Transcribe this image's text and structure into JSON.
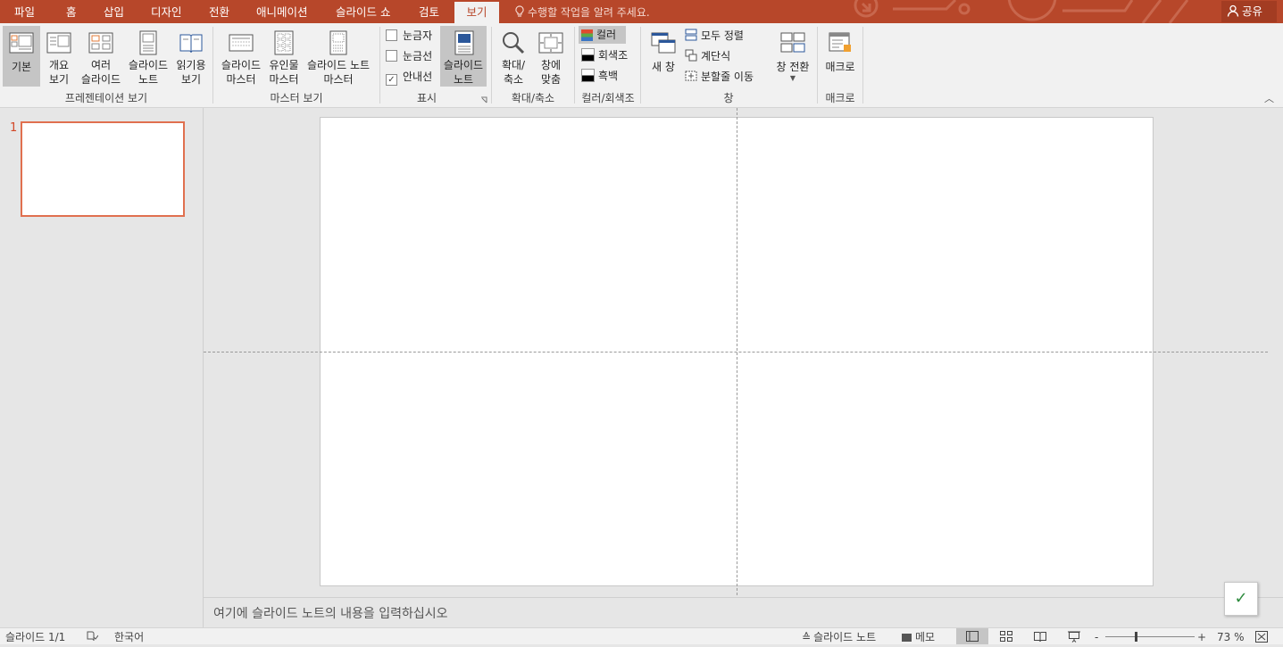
{
  "tabs": [
    {
      "label": "파일",
      "active": false
    },
    {
      "label": "홈",
      "active": false
    },
    {
      "label": "삽입",
      "active": false
    },
    {
      "label": "디자인",
      "active": false
    },
    {
      "label": "전환",
      "active": false
    },
    {
      "label": "애니메이션",
      "active": false
    },
    {
      "label": "슬라이드 쇼",
      "active": false
    },
    {
      "label": "검토",
      "active": false
    },
    {
      "label": "보기",
      "active": true
    }
  ],
  "tell_me": "수행할 작업을 알려 주세요.",
  "share_label": "공유",
  "ribbon": {
    "presentation_views": {
      "group_label": "프레젠테이션 보기",
      "normal": "기본",
      "outline": [
        "개요",
        "보기"
      ],
      "slide_sorter": [
        "여러",
        "슬라이드"
      ],
      "notes_page": [
        "슬라이드",
        "노트"
      ],
      "reading_view": [
        "읽기용",
        "보기"
      ]
    },
    "master_views": {
      "group_label": "마스터 보기",
      "slide_master": [
        "슬라이드",
        "마스터"
      ],
      "handout_master": [
        "유인물",
        "마스터"
      ],
      "notes_master": [
        "슬라이드 노트",
        "마스터"
      ]
    },
    "show": {
      "group_label": "표시",
      "ruler": {
        "label": "눈금자",
        "checked": false
      },
      "gridlines": {
        "label": "눈금선",
        "checked": false
      },
      "guides": {
        "label": "안내선",
        "checked": true
      },
      "notes": [
        "슬라이드",
        "노트"
      ]
    },
    "zoom": {
      "group_label": "확대/축소",
      "zoom": [
        "확대/",
        "축소"
      ],
      "fit_window": [
        "창에",
        "맞춤"
      ]
    },
    "color": {
      "group_label": "컬러/회색조",
      "color": "컬러",
      "grayscale": "회색조",
      "bw": "흑백"
    },
    "window": {
      "group_label": "창",
      "new_window": "새 창",
      "arrange_all": "모두 정렬",
      "cascade": "계단식",
      "move_split": "분할줄 이동",
      "switch_windows": "창 전환"
    },
    "macros": {
      "group_label": "매크로",
      "macros": "매크로"
    }
  },
  "thumbnails": {
    "slide_number": "1"
  },
  "notes_placeholder": "여기에 슬라이드 노트의 내용을 입력하십시오",
  "status": {
    "slide_info": "슬라이드 1/1",
    "language": "한국어",
    "notes_label": "슬라이드 노트",
    "comments_label": "메모",
    "zoom_percent": "73 %"
  },
  "colors": {
    "accent": "#b7472a",
    "thumb_border": "#e0704f"
  }
}
